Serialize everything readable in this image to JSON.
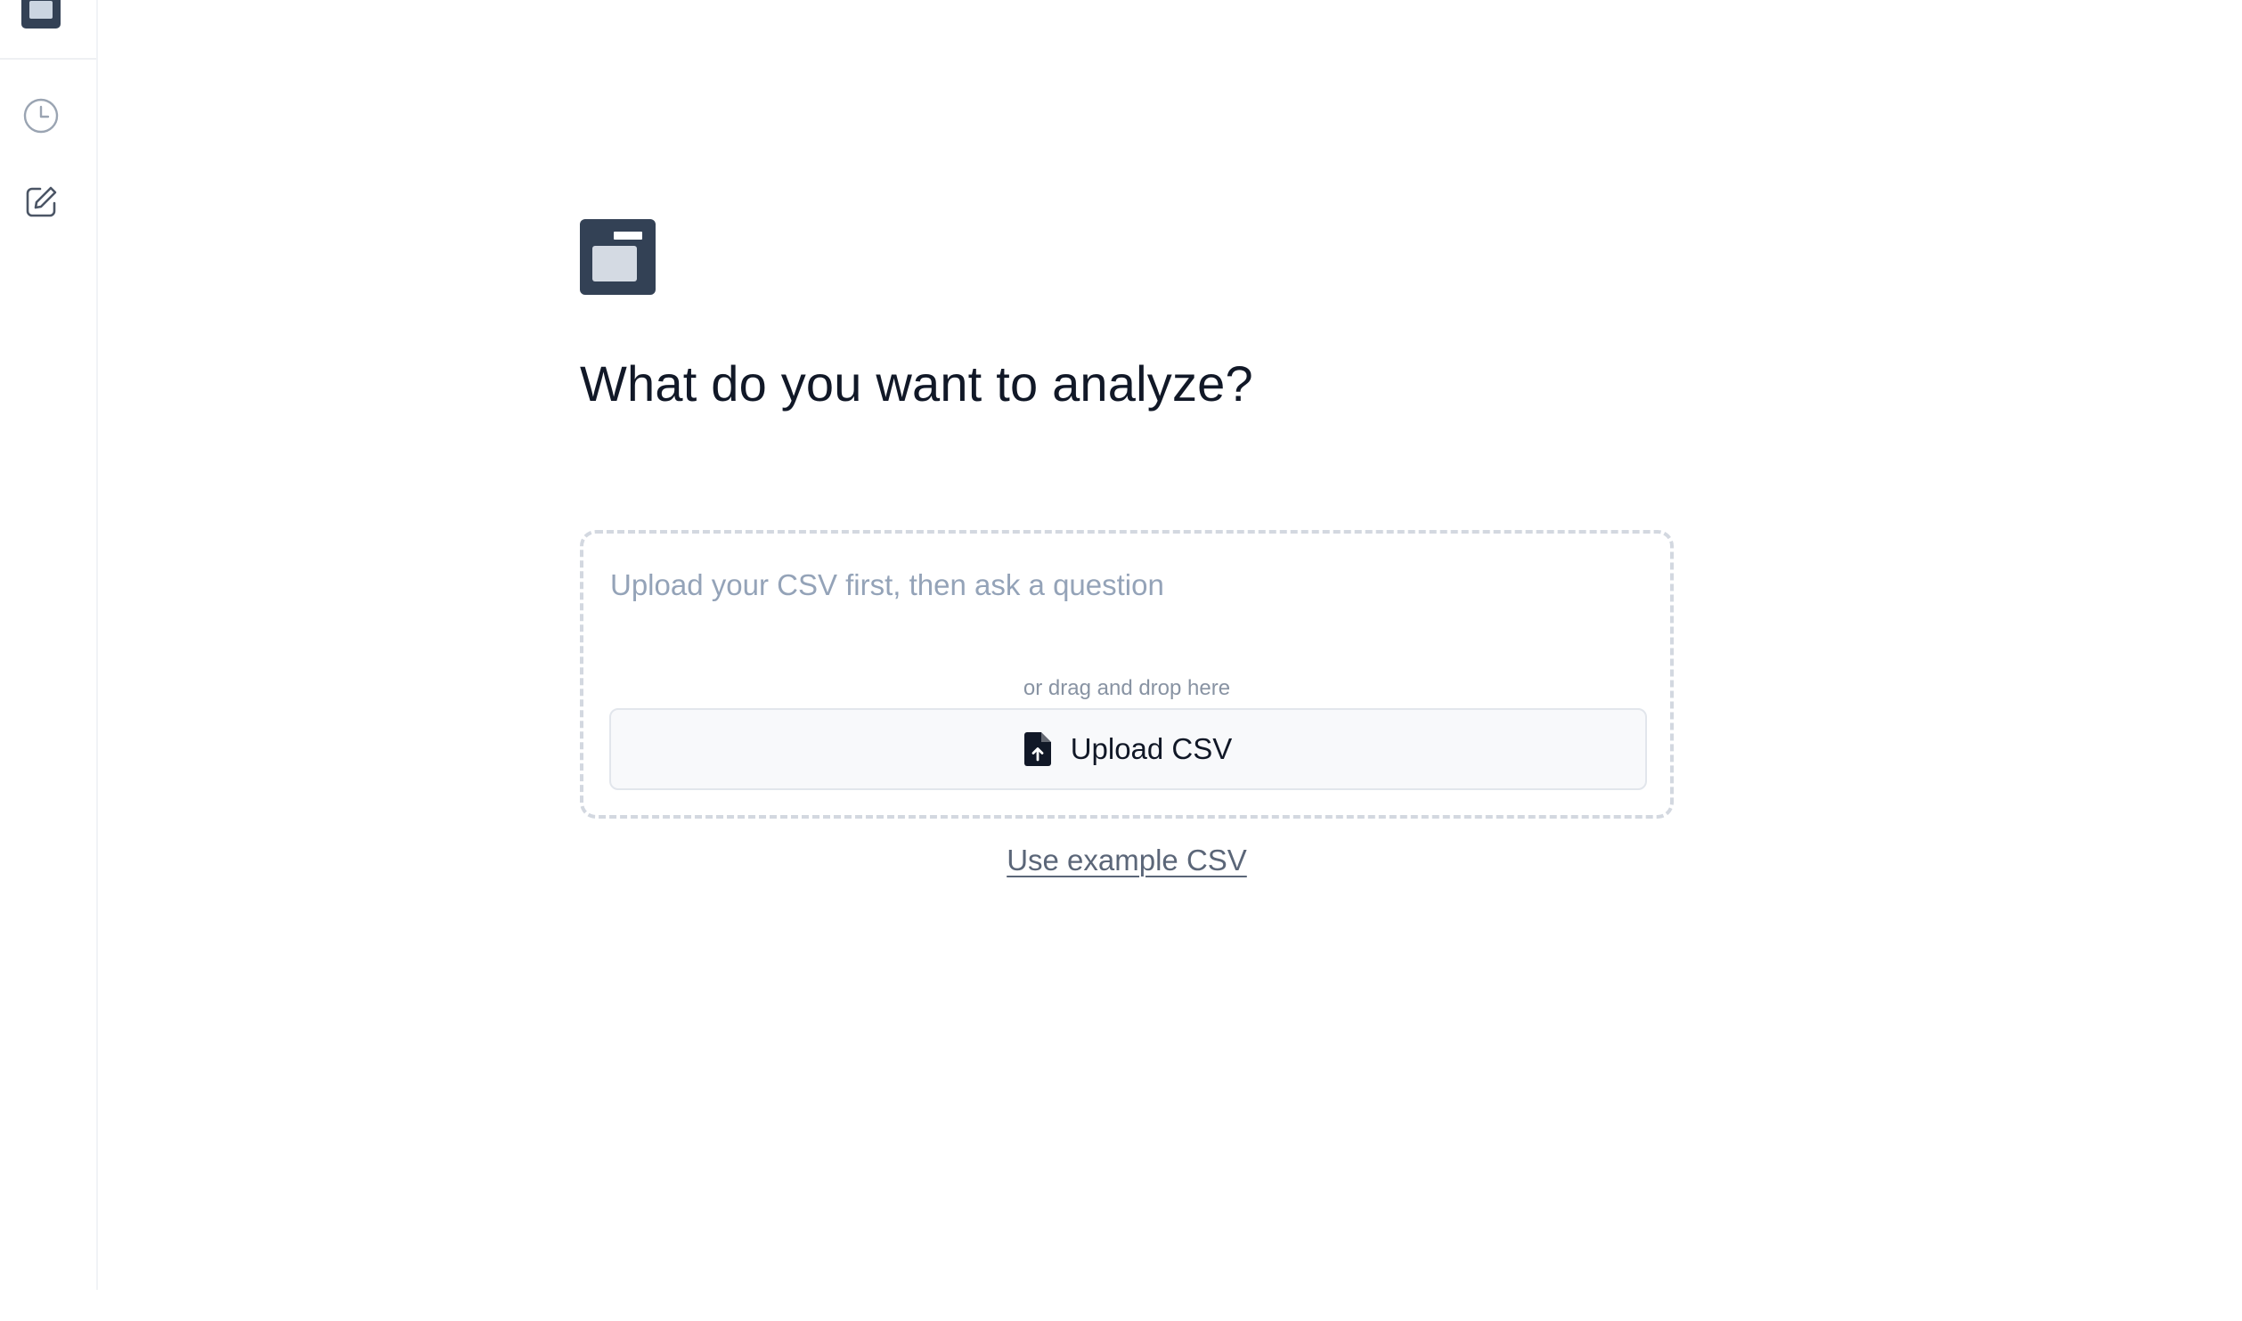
{
  "sidebar": {
    "items": [
      {
        "name": "history",
        "icon": "clock-icon"
      },
      {
        "name": "new-analysis",
        "icon": "edit-icon"
      }
    ]
  },
  "main": {
    "headline": "What do you want to analyze?",
    "question_input": {
      "placeholder": "Upload your CSV first, then ask a question",
      "value": ""
    },
    "drag_hint": "or drag and drop here",
    "upload_button": {
      "label": "Upload CSV",
      "icon": "file-upload-icon"
    },
    "example_link": "Use example CSV"
  },
  "colors": {
    "brand": "#334155",
    "muted_text": "#94a3b8",
    "dashed_border": "#d3d8e0",
    "button_bg": "#f8f9fb",
    "link": "#5b6678"
  }
}
